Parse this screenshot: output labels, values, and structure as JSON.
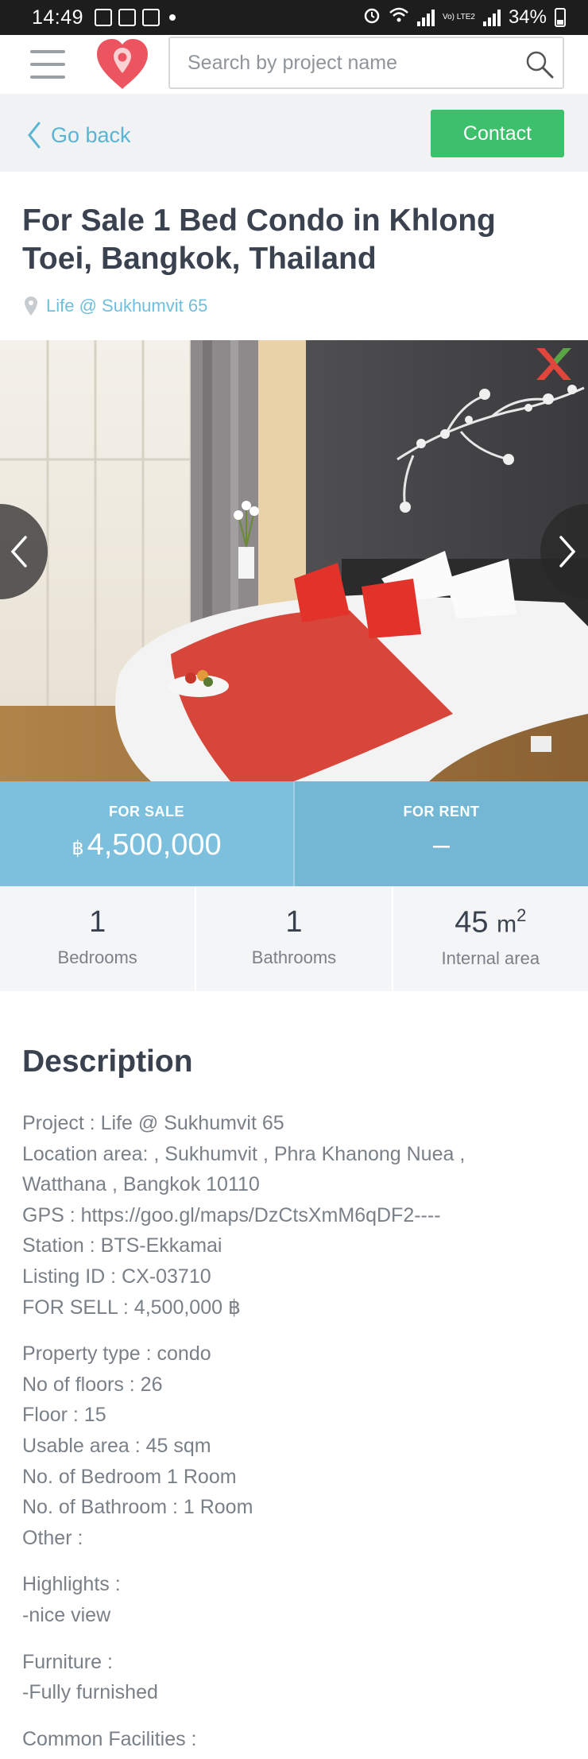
{
  "status_bar": {
    "time": "14:49",
    "battery": "34%",
    "lte_label": "Vo) LTE2"
  },
  "header": {
    "search_placeholder": "Search by project name"
  },
  "nav": {
    "go_back": "Go back",
    "contact": "Contact"
  },
  "listing": {
    "title": "For Sale 1 Bed Condo in Khlong Toei, Bangkok, Thailand",
    "project_link": "Life @ Sukhumvit 65"
  },
  "prices": {
    "sale_label": "FOR SALE",
    "sale_currency": "฿",
    "sale_value": "4,500,000",
    "rent_label": "FOR RENT",
    "rent_value": "–"
  },
  "specs": {
    "bedrooms_value": "1",
    "bedrooms_label": "Bedrooms",
    "bathrooms_value": "1",
    "bathrooms_label": "Bathrooms",
    "area_value": "45",
    "area_unit": "m",
    "area_sup": "2",
    "area_label": "Internal area"
  },
  "description": {
    "heading": "Description",
    "paragraphs": [
      [
        "Project : Life @ Sukhumvit 65",
        "Location area: , Sukhumvit , Phra Khanong Nuea ,",
        "Watthana , Bangkok 10110",
        "GPS : https://goo.gl/maps/DzCtsXmM6qDF2----",
        "Station : BTS-Ekkamai",
        "Listing ID : CX-03710",
        "FOR SELL : 4,500,000 ฿"
      ],
      [
        "Property type : condo",
        "No of floors : 26",
        "Floor : 15",
        "Usable area : 45 sqm",
        "No. of Bedroom 1 Room",
        "No. of Bathroom : 1 Room",
        "Other :"
      ],
      [
        "Highlights :",
        "-nice view"
      ],
      [
        "Furniture :",
        "-Fully furnished"
      ],
      [
        "Common Facilities :"
      ]
    ]
  },
  "colors": {
    "accent_blue": "#7dc0dd",
    "contact_green": "#3cc06b",
    "link_blue": "#5ab4d3"
  }
}
